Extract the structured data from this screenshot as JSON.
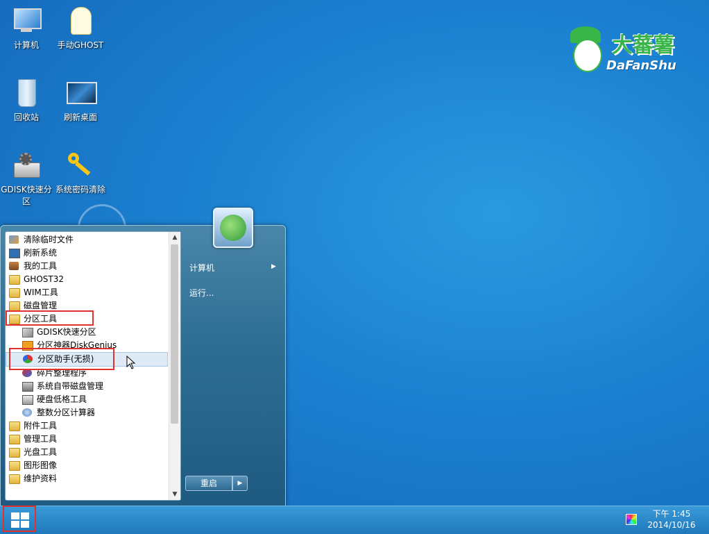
{
  "desktop": {
    "icons": [
      {
        "label": "计算机"
      },
      {
        "label": "手动GHOST"
      },
      {
        "label": "回收站"
      },
      {
        "label": "刷新桌面"
      },
      {
        "label": "GDISK快速分区"
      },
      {
        "label": "系统密码清除"
      }
    ],
    "logo": {
      "text": "DaFanShu",
      "text_cn": "大蕃薯"
    }
  },
  "start_menu": {
    "programs": [
      {
        "label": "清除临时文件",
        "icon": "broom-icon"
      },
      {
        "label": "刷新系统",
        "icon": "monitor-icon"
      },
      {
        "label": "我的工具",
        "icon": "toolbox-icon"
      },
      {
        "label": "GHOST32",
        "icon": "folder-icon"
      },
      {
        "label": "WIM工具",
        "icon": "folder-icon"
      },
      {
        "label": "磁盘管理",
        "icon": "folder-icon"
      },
      {
        "label": "分区工具",
        "icon": "folder-icon"
      },
      {
        "label": "GDISK快速分区",
        "icon": "disk-tool-icon"
      },
      {
        "label": "分区神器DiskGenius",
        "icon": "diskgenius-icon"
      },
      {
        "label": "分区助手(无损)",
        "icon": "partition-assistant-icon"
      },
      {
        "label": "碎片整理程序",
        "icon": "defrag-icon"
      },
      {
        "label": "系统自带磁盘管理",
        "icon": "disk-manage-icon"
      },
      {
        "label": "硬盘低格工具",
        "icon": "harddisk-icon"
      },
      {
        "label": "整数分区计算器",
        "icon": "calculator-icon"
      },
      {
        "label": "附件工具",
        "icon": "folder-icon"
      },
      {
        "label": "管理工具",
        "icon": "folder-icon"
      },
      {
        "label": "光盘工具",
        "icon": "folder-icon"
      },
      {
        "label": "图形图像",
        "icon": "folder-icon"
      },
      {
        "label": "维护资料",
        "icon": "folder-icon"
      }
    ],
    "right_panel": {
      "computer_label": "计算机",
      "run_label": "运行..."
    },
    "restart_label": "重启"
  },
  "taskbar": {
    "time": "下午 1:45",
    "date": "2014/10/16"
  },
  "colors": {
    "desktop_bg": "#1b7fcf",
    "highlight_red": "#e03030"
  }
}
